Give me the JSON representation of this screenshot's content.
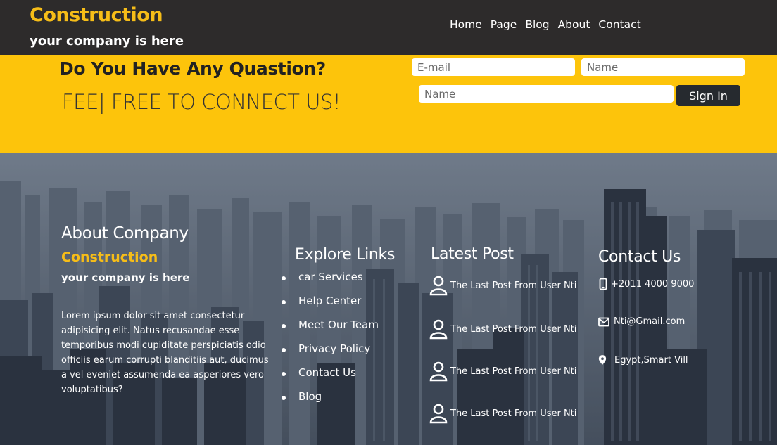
{
  "header": {
    "brand": "Construction",
    "tagline": "your company is here",
    "nav": [
      "Home",
      "Page",
      "Blog",
      "About",
      "Contact"
    ]
  },
  "band": {
    "question": "Do You Have Any Quastion?",
    "subtitle": "FEE| FREE TO CONNECT US!",
    "email_placeholder": "E-mail",
    "name_placeholder": "Name",
    "name2_placeholder": "Name",
    "signin_label": "Sign In"
  },
  "about": {
    "title": "About Company",
    "brand": "Construction",
    "tagline": "your company is here",
    "text": "Lorem ipsum dolor sit amet consectetur adipisicing elit. Natus recusandae esse temporibus modi cupiditate perspiciatis odio officiis earum corrupti blanditiis aut, ducimus a vel eveniet assumenda ea asperiores vero voluptatibus?"
  },
  "explore": {
    "title": "Explore Links",
    "links": [
      "car Services",
      "Help Center",
      "Meet Our Team",
      "Privacy Policy",
      "Contact Us",
      "Blog"
    ]
  },
  "latest": {
    "title": "Latest Post",
    "posts": [
      "The Last Post From User Nti",
      "The Last Post From User Nti",
      "The Last Post From User Nti",
      "The Last Post From User Nti"
    ]
  },
  "contact": {
    "title": "Contact Us",
    "phone": "+2011 4000 9000",
    "email": "Nti@Gmail.com",
    "address": "Egypt,Smart Vill"
  },
  "colors": {
    "accent": "#f6bd18",
    "band": "#fdc40b",
    "header_bg": "#2d2b2b",
    "button_bg": "#262a2f"
  },
  "icons": {
    "post": "user-icon",
    "phone": "phone-icon",
    "email": "envelope-icon",
    "address": "map-pin-icon"
  }
}
